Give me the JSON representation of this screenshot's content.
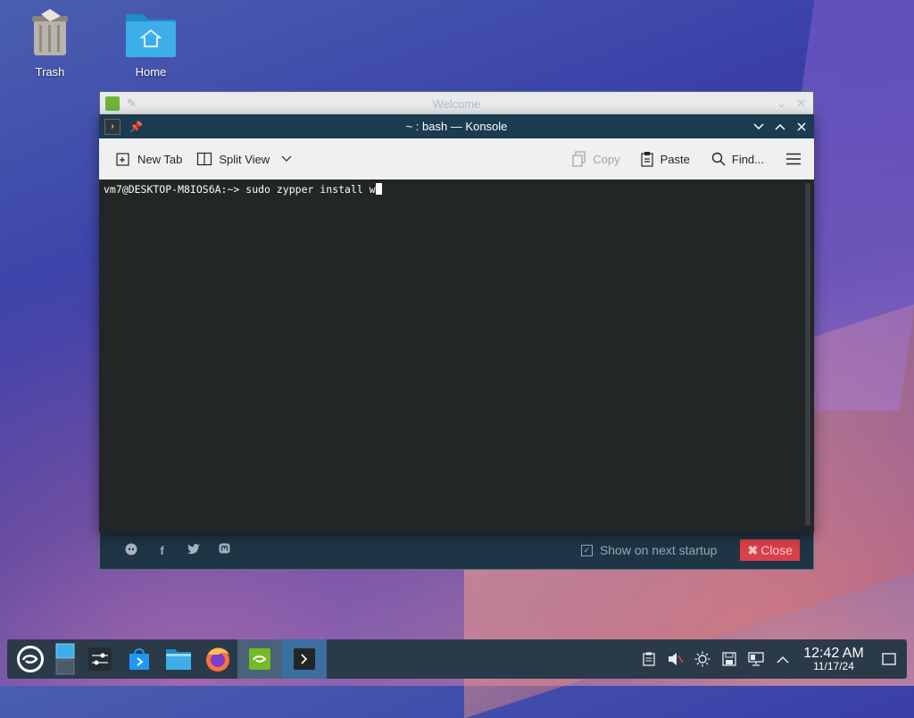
{
  "desktop": {
    "icons": [
      {
        "label": "Trash",
        "icon": "trash-icon"
      },
      {
        "label": "Home",
        "icon": "folder-home-icon"
      }
    ]
  },
  "welcome_window": {
    "title": "Welcome",
    "show_on_startup_label": "Show on next startup",
    "close_label": "Close",
    "social_icons": [
      "reddit-icon",
      "facebook-icon",
      "twitter-icon",
      "mastodon-icon"
    ]
  },
  "konsole": {
    "title": "~ : bash — Konsole",
    "toolbar": {
      "new_tab": "New Tab",
      "split_view": "Split View",
      "copy": "Copy",
      "paste": "Paste",
      "find": "Find..."
    },
    "terminal": {
      "prompt": "vm7@DESKTOP-M8IOS6A:~>",
      "command": "sudo zypper install w"
    }
  },
  "taskbar": {
    "clock_time": "12:42 AM",
    "clock_date": "11/17/24"
  },
  "colors": {
    "konsole_titlebar": "#1b3b50",
    "terminal_bg": "#232627",
    "close_button": "#d9404a",
    "taskbar_bg": "#2a3a49"
  }
}
